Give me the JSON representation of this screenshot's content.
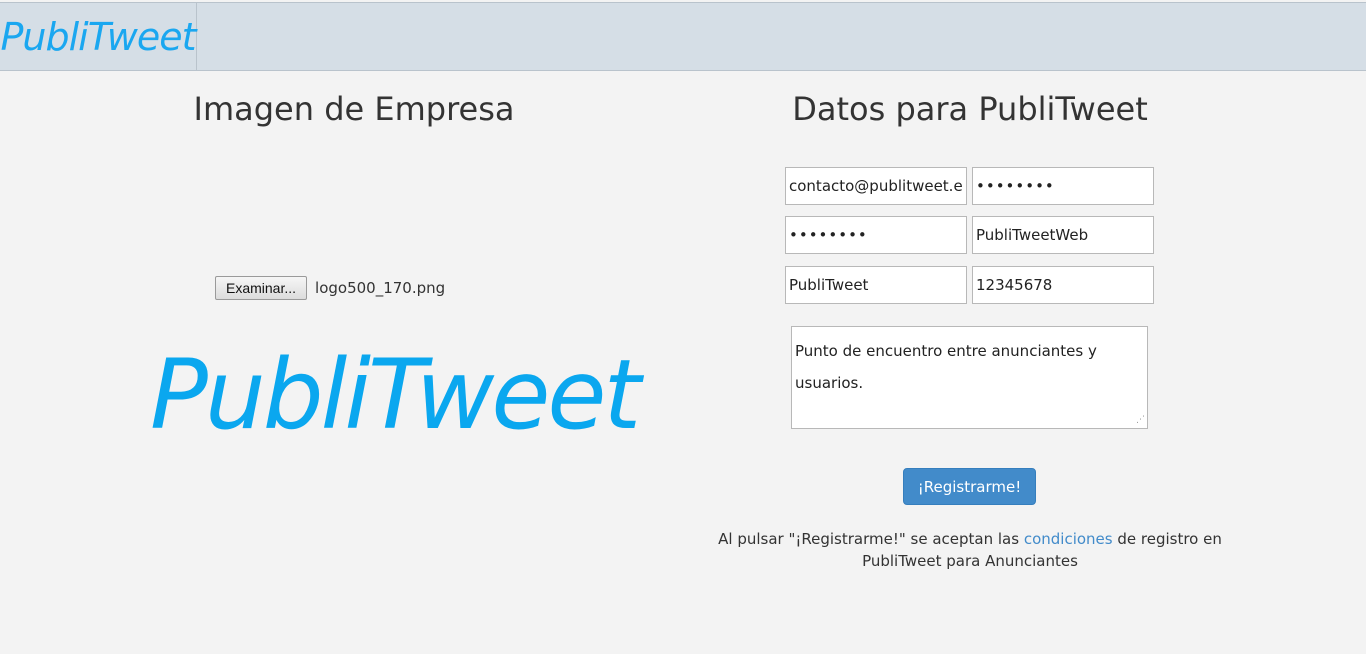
{
  "navbar": {
    "brand": "PubliTweet"
  },
  "left": {
    "heading": "Imagen de Empresa",
    "file_button": "Examinar...",
    "file_name": "logo500_170.png",
    "logo_text": "PubliTweet"
  },
  "right": {
    "heading": "Datos para PubliTweet",
    "fields": {
      "email": "contacto@publitweet.e",
      "password": "••••••••",
      "password_confirm": "••••••••",
      "username": "PubliTweetWeb",
      "company": "PubliTweet",
      "phone": "12345678"
    },
    "description": "Punto de encuentro entre anunciantes y usuarios.",
    "submit_label": "¡Registrarme!",
    "terms": {
      "before": "Al pulsar \"¡Registrarme!\" se aceptan las ",
      "link": "condiciones",
      "after": " de registro en PubliTweet para Anunciantes"
    }
  },
  "colors": {
    "brand": "#1aa7f0",
    "navbar_bg": "#d5dee6",
    "button": "#428bca"
  }
}
